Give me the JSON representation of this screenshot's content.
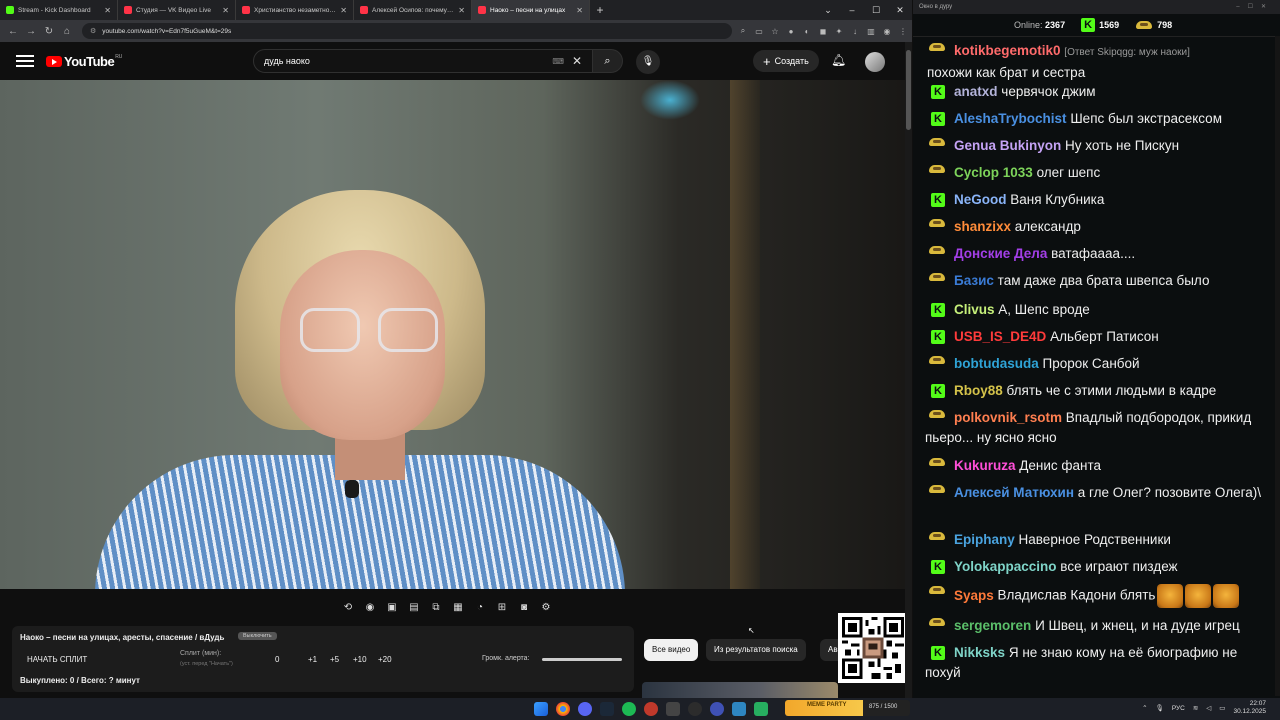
{
  "browser": {
    "tabs": [
      {
        "title": "Stream - Kick Dashboard",
        "color": "#53fc18"
      },
      {
        "title": "Студия — VK Видео Live",
        "color": "#ff3347"
      },
      {
        "title": "Христианство незаметно укра",
        "color": "#ff3347"
      },
      {
        "title": "Алексей Осипов: почему Бог",
        "color": "#ff3347"
      },
      {
        "title": "Наоко – песни на улицах",
        "color": "#ff3347"
      }
    ],
    "url": "youtube.com/watch?v=Edn7f5uGueM&t=29s"
  },
  "youtube": {
    "logo_text": "YouTube",
    "region": "RU",
    "search_value": "дудь наоко",
    "create_label": "Создать"
  },
  "split_panel": {
    "title": "Наоко – песни на улицах, аресты, спасение / вДудь",
    "small_button": "Выключить",
    "start_label": "НАЧАТЬ СПЛИТ",
    "split_label": "Сплит (мин):",
    "split_hint": "(уст. перед \"Начать\")",
    "values": [
      "0",
      "+1",
      "+5",
      "+10",
      "+20"
    ],
    "volume_label": "Громк. алерта:",
    "status": "Выкуплено: 0 / Всего: ? минут"
  },
  "chips": [
    "Все видео",
    "Из результатов поиска",
    "Ав"
  ],
  "chat": {
    "window_title": "Окно в дуру",
    "online_label": "Online:",
    "online_count": "2367",
    "kick_count": "1569",
    "twitch_count": "798",
    "messages": [
      {
        "platform": "twitch",
        "user": "kotikbegemotik0",
        "color": "#ff6b6b",
        "reply": "[Ответ Skipqgg: муж наоки]",
        "text": "похожи как брат и сестра"
      },
      {
        "platform": "kick",
        "user": "anatxd",
        "color": "#b3b3d9",
        "text": "червячок джим"
      },
      {
        "platform": "kick",
        "user": "AleshaTrybochist",
        "color": "#4a90e2",
        "text": "Шепс был экстрасексом"
      },
      {
        "platform": "twitch",
        "user": "Genua Bukinyon",
        "color": "#c5a3f5",
        "text": "Ну хоть не Пискун"
      },
      {
        "platform": "twitch",
        "user": "Cyclop 1033",
        "color": "#7dd35a",
        "text": "олег шепс"
      },
      {
        "platform": "kick",
        "user": "NeGood",
        "color": "#8ab4f8",
        "text": "Ваня Клубника"
      },
      {
        "platform": "twitch",
        "user": "shanzixx",
        "color": "#ff8c3a",
        "text": "александр"
      },
      {
        "platform": "twitch",
        "user": "Донские Дела",
        "color": "#a33fe8",
        "text": "ватафаааа...."
      },
      {
        "platform": "twitch",
        "user": "Базис",
        "color": "#3a7bd5",
        "text": "там даже два брата швепса было"
      },
      {
        "platform": "kick",
        "user": "Clivus",
        "color": "#c6f07a",
        "text": "А, Шепс вроде"
      },
      {
        "platform": "kick",
        "user": "USB_IS_DE4D",
        "color": "#ff3b3b",
        "text": "Альберт Патисон"
      },
      {
        "platform": "twitch",
        "user": "bobtudasuda",
        "color": "#2fa3d6",
        "text": "Пророк Санбой"
      },
      {
        "platform": "kick",
        "user": "Rboy88",
        "color": "#d4c24a",
        "text": "блять че с этими людьми в кадре"
      },
      {
        "platform": "twitch",
        "user": "polkovnik_rsotm",
        "color": "#ff7f50",
        "text": "Впадлый подбородок, прикид пьеро... ну ясно ясно"
      },
      {
        "platform": "twitch",
        "user": "Kukuruza",
        "color": "#ff4fd8",
        "text": "Денис фанта"
      },
      {
        "platform": "twitch",
        "user": "Алексей Матюхин",
        "color": "#4a90e2",
        "text": "а гле Олег? позовите Олега)\\"
      },
      {
        "platform": "twitch",
        "user": "Epiphany",
        "color": "#4aa3df",
        "text": "Наверное Родственники"
      },
      {
        "platform": "kick",
        "user": "Yolokappaccino",
        "color": "#7fd4c8",
        "text": "все играют пиздеж"
      },
      {
        "platform": "twitch",
        "user": "Syaps",
        "color": "#ff7a3a",
        "text": "Владислав Кадони блять"
      },
      {
        "platform": "twitch",
        "user": "sergemoren",
        "color": "#5bbf6a",
        "text": "И Швец, и жнец, и на дуде игрец"
      },
      {
        "platform": "kick",
        "user": "Nikksks",
        "color": "#7fd4c8",
        "text": "Я не знаю кому на её биографию не похуй"
      }
    ]
  },
  "taskbar": {
    "widget_label": "MEME PARTY",
    "widget_progress": "875 / 1500",
    "lang": "РУС",
    "time": "22:07",
    "date": "30.12.2025"
  }
}
